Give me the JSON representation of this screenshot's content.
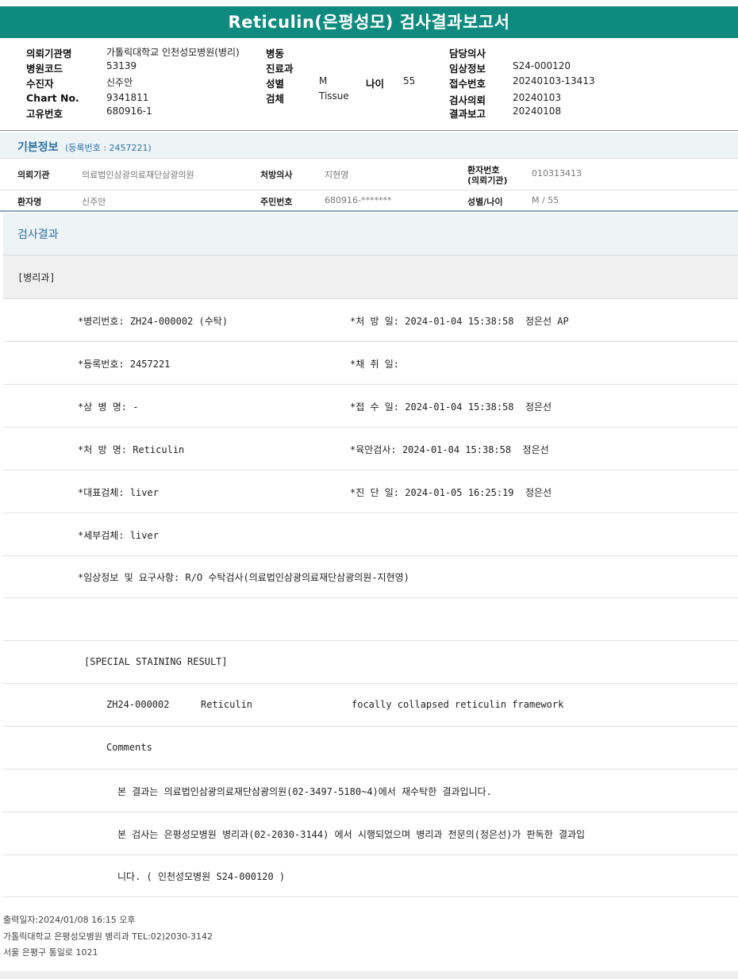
{
  "title": "Reticulin(은평성모) 검사결과보고서",
  "header": {
    "fields": [
      {
        "label": "의뢰기관명",
        "value": "가톨릭대학교 인천성모병원(병리)"
      },
      {
        "label": "병원코드",
        "value": "53139"
      },
      {
        "label": "수진자",
        "value": "신주안"
      },
      {
        "label": "Chart No.",
        "value": "9341811"
      },
      {
        "label": "고유번호",
        "value": "680916-1"
      },
      {
        "label": "병동",
        "value": ""
      },
      {
        "label": "진료과",
        "value": ""
      },
      {
        "label": "성별",
        "value": "M"
      },
      {
        "label": "나이",
        "value": "55"
      },
      {
        "label": "검체",
        "value": "Tissue"
      },
      {
        "label": "담당의사",
        "value": ""
      },
      {
        "label": "임상정보",
        "value": "S24-000120"
      },
      {
        "label": "접수번호",
        "value": "20240103-13413"
      },
      {
        "label": "검사의뢰",
        "value": "20240103"
      },
      {
        "label": "결과보고",
        "value": "20240108"
      }
    ]
  },
  "basic": {
    "title": "기본정보",
    "reg_no": "(등록번호 : 2457221)",
    "fields": [
      {
        "label": "의뢰기관",
        "value": "의료법인삼광의료재단삼광의원"
      },
      {
        "label": "처방의사",
        "value": "지현영"
      },
      {
        "label_line1": "환자번호",
        "label_line2": "(의뢰기관)",
        "value": "010313413"
      },
      {
        "label": "환자명",
        "value": "신주안"
      },
      {
        "label": "주민번호",
        "value": "680916-*******"
      },
      {
        "label": "성별/나이",
        "value": "M / 55"
      }
    ]
  },
  "result": {
    "title": "검사결과",
    "dept": "[병리과]",
    "rows": [
      {
        "left": "*병리번호: ZH24-000002 (수탁)",
        "right": "*처 방 일: 2024-01-04 15:38:58  정은선 AP"
      },
      {
        "left": "*등록번호: 2457221",
        "right": "*채 취 일:"
      },
      {
        "left": "*상 병 명: -",
        "right": "*접 수 일: 2024-01-04 15:38:58  정은선"
      },
      {
        "left": "*처 방 명: Reticulin",
        "right": "*육안검사: 2024-01-04 15:38:58  정은선"
      },
      {
        "left": "*대표검체: liver",
        "right": "*진 단 일: 2024-01-05 16:25:19  정은선"
      },
      {
        "left": "*세부검체: liver",
        "right": ""
      },
      {
        "left": "*임상정보 및 요구사항: R/O 수탁검사(의료법인삼광의료재단삼광의원-지현영)",
        "right": ""
      }
    ],
    "special_title": "[SPECIAL STAINING RESULT]",
    "stain": {
      "id": "ZH24-000002",
      "name": "Reticulin",
      "finding": "focally collapsed reticulin framework"
    },
    "comments_label": "Comments",
    "comment_lines": [
      "본 결과는 의료법인삼광의료재단삼광의원(02-3497-5180~4)에서 재수탁한 결과입니다.",
      "본 검사는 은평성모병원 병리과(02-2030-3144) 에서 시행되었으며 병리과 전문의(정은선)가 판독한 결과입",
      "니다. ( 인천성모병원 S24-000120 )"
    ]
  },
  "footer": {
    "printed": "출력일자:2024/01/08 16:15 오후",
    "org": "가톨릭대학교 은평성모병원 병리과 TEL:02)2030-3142",
    "address": "서울 은평구 통일로 1021"
  }
}
